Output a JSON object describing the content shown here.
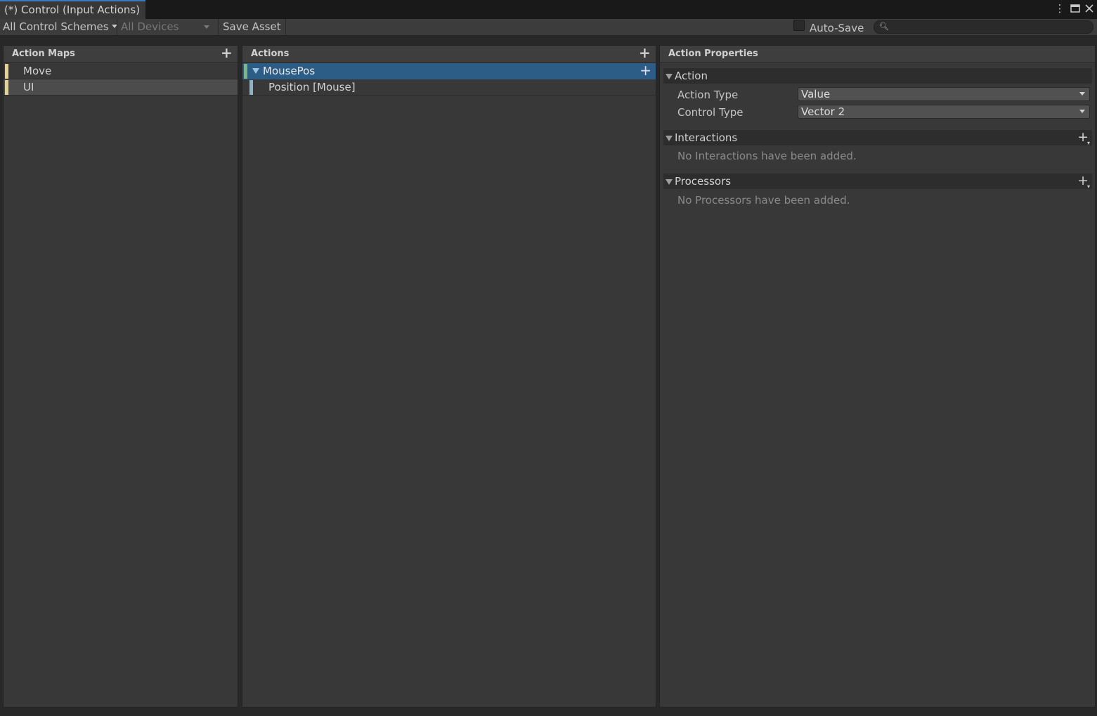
{
  "window": {
    "tab_title": "(*) Control (Input Actions)"
  },
  "toolbar": {
    "control_schemes": "All Control Schemes",
    "devices": "All Devices",
    "save_asset": "Save Asset",
    "auto_save_label": "Auto-Save",
    "auto_save_checked": false,
    "search_placeholder": ""
  },
  "action_maps": {
    "header": "Action Maps",
    "items": [
      {
        "label": "Move",
        "selected": false
      },
      {
        "label": "UI",
        "selected": true
      }
    ]
  },
  "actions": {
    "header": "Actions",
    "items": [
      {
        "label": "MousePos",
        "type": "action",
        "selected": true
      },
      {
        "label": "Position [Mouse]",
        "type": "binding",
        "selected": false
      }
    ]
  },
  "properties": {
    "header": "Action Properties",
    "action_section": "Action",
    "action_type_label": "Action Type",
    "action_type_value": "Value",
    "control_type_label": "Control Type",
    "control_type_value": "Vector 2",
    "interactions_section": "Interactions",
    "interactions_empty": "No Interactions have been added.",
    "processors_section": "Processors",
    "processors_empty": "No Processors have been added."
  },
  "colors": {
    "selection": "#2c5d87",
    "map_bar": "#e8d28a",
    "action_bar": "#7fb77a",
    "binding_bar": "#8ab5c8"
  }
}
